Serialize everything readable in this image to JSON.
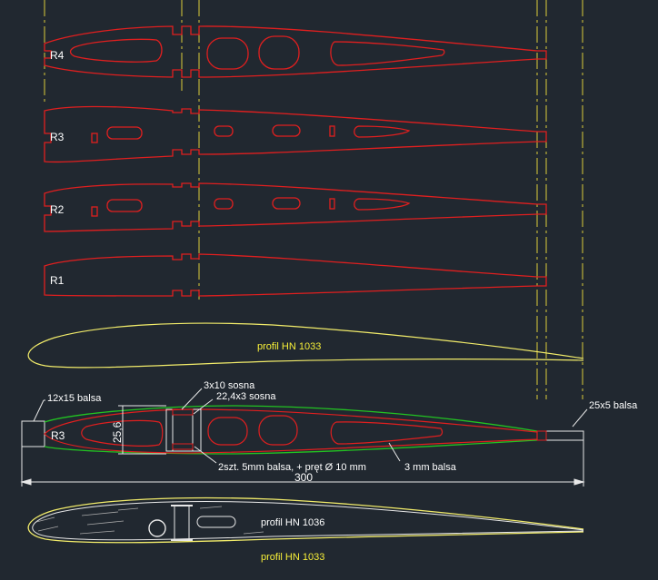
{
  "colors": {
    "background": "#212830",
    "rib_outline": "#e01f1f",
    "profile_yellow": "#f2ec6a",
    "label_yellow": "#f7ef38",
    "centerline": "#dccd3a",
    "spar_green": "#22c322",
    "dimension": "#e8e8e8",
    "text": "#ffffff"
  },
  "ribs": [
    {
      "label": "R4"
    },
    {
      "label": "R3"
    },
    {
      "label": "R2"
    },
    {
      "label": "R1"
    }
  ],
  "profiles": {
    "top_label": "profil HN 1033",
    "bottom_label_white": "profil HN 1036",
    "bottom_label_yellow": "profil HN 1033"
  },
  "assembly": {
    "rib_label": "R3",
    "callouts": {
      "leading_edge": "12x15 balsa",
      "spar_top": "3x10 sosna",
      "spar_web": "22,4x3 sosna",
      "trailing_edge": "25x5 balsa",
      "spar_bottom": "2szt. 5mm balsa, + pręt Ø 10 mm",
      "sheeting": "3 mm balsa"
    },
    "dim_height": "25,6",
    "dim_chord": "300"
  }
}
